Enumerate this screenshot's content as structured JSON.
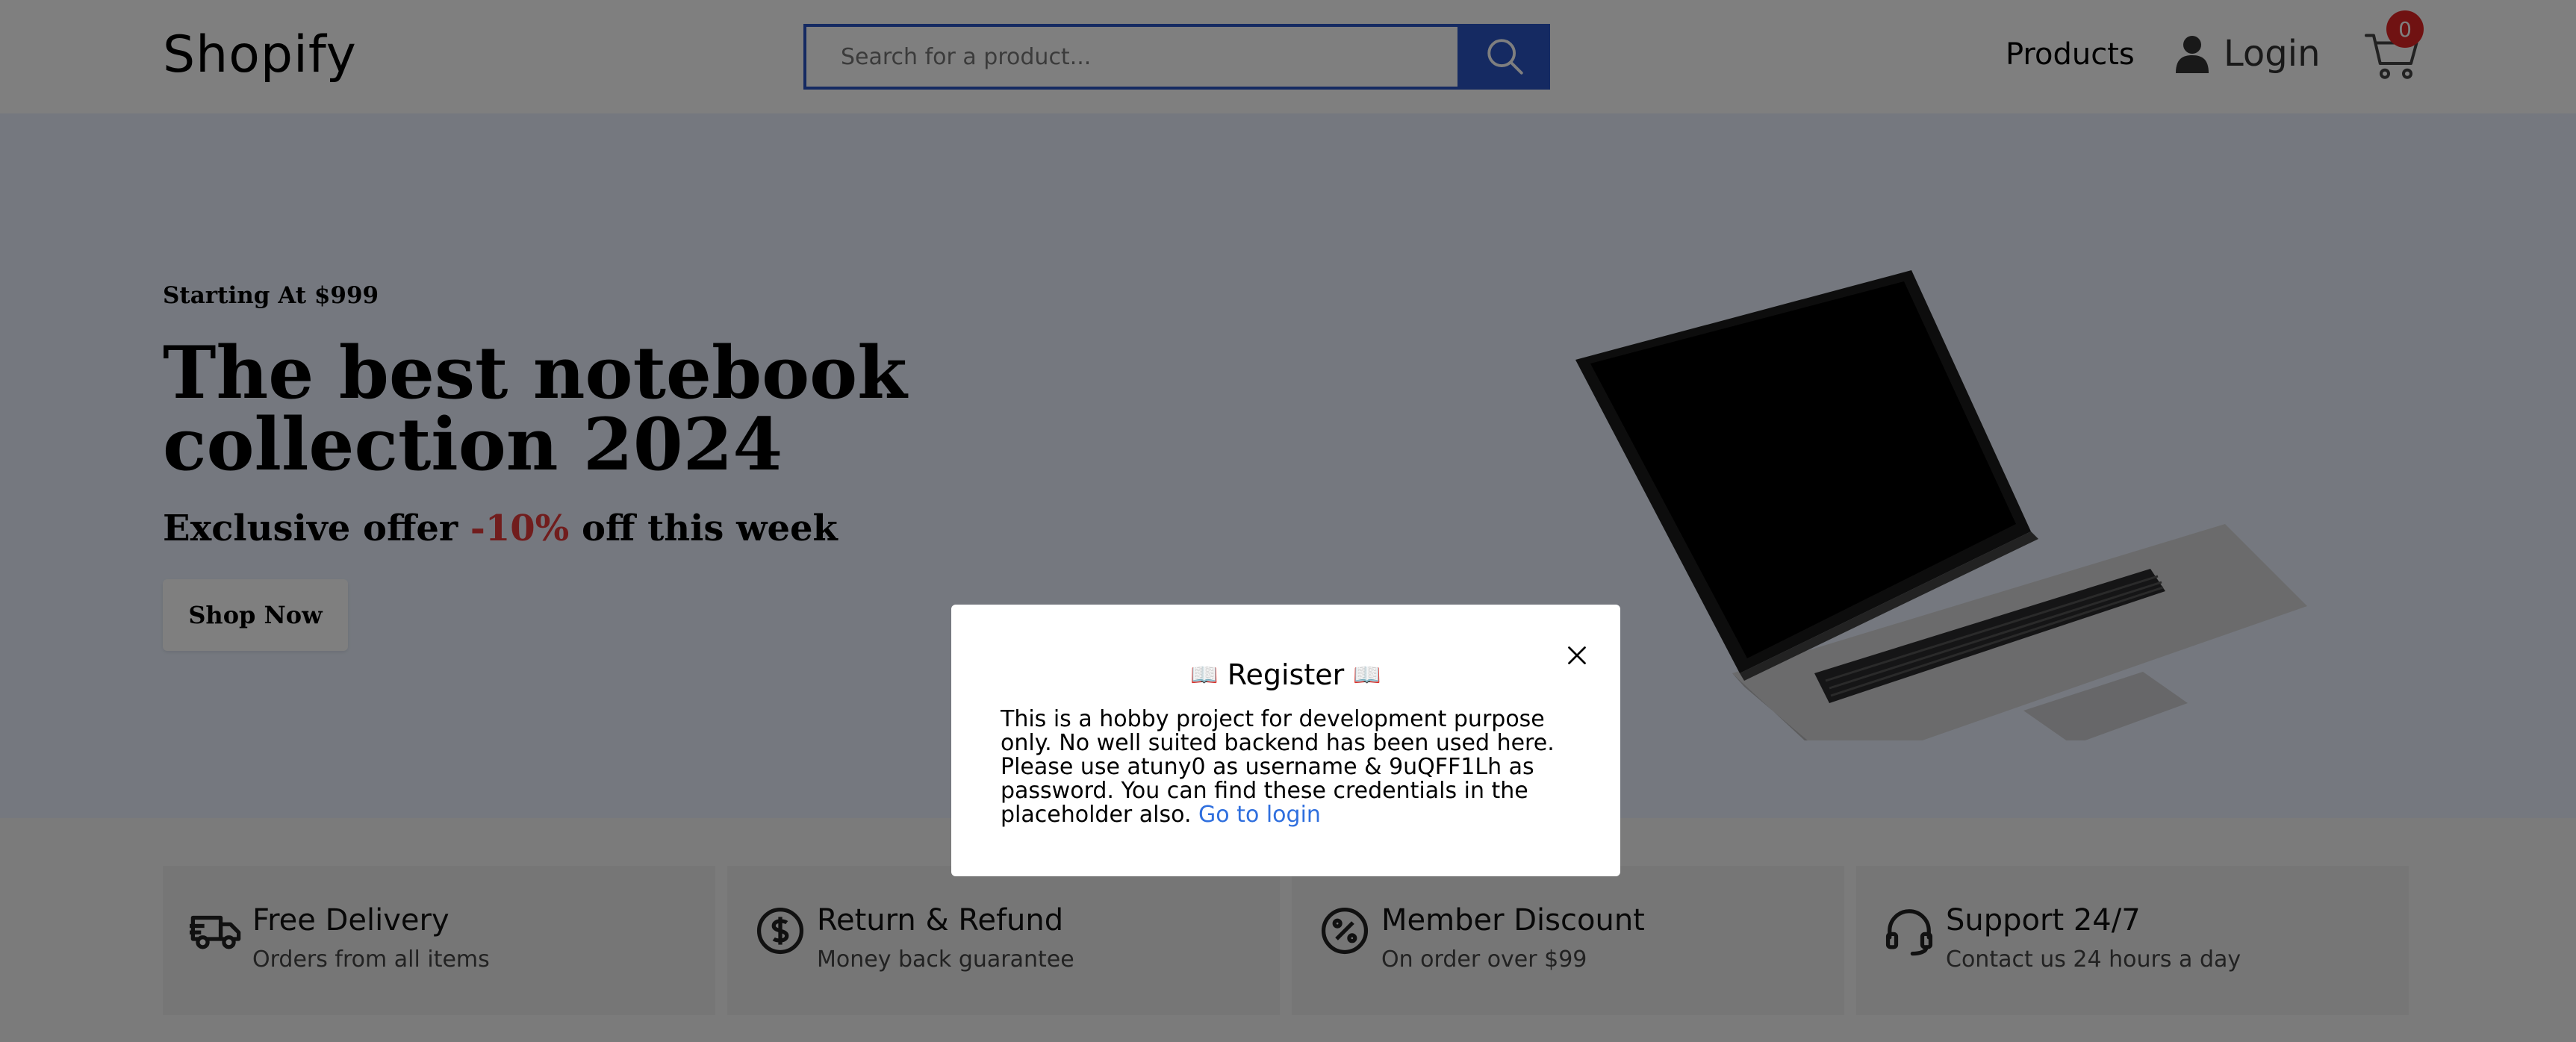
{
  "header": {
    "logo": "Shopify",
    "search_placeholder": "Search for a product...",
    "products_label": "Products",
    "login_label": "Login",
    "cart_count": "0"
  },
  "hero": {
    "kicker": "Starting At $999",
    "title": "The best notebook collection 2024",
    "offer_prefix": "Exclusive offer ",
    "offer_accent": "-10%",
    "offer_suffix": " off this week",
    "shop_button": "Shop Now"
  },
  "features": [
    {
      "title": "Free Delivery",
      "subtitle": "Orders from all items",
      "icon": "truck-icon"
    },
    {
      "title": "Return & Refund",
      "subtitle": "Money back guarantee",
      "icon": "dollar-circle-icon"
    },
    {
      "title": "Member Discount",
      "subtitle": "On order over $99",
      "icon": "percent-circle-icon"
    },
    {
      "title": "Support 24/7",
      "subtitle": "Contact us 24 hours a day",
      "icon": "headset-icon"
    }
  ],
  "modal": {
    "title": "Register",
    "title_emoji": "📖",
    "body": "This is a hobby project for development purpose only. No well suited backend has been used here. Please use atuny0 as username & 9uQFF1Lh as password. You can find these credentials in the placeholder also.",
    "link": "Go to login"
  },
  "colors": {
    "accent_blue": "#2b55c4",
    "offer_red": "#e33b3b",
    "link_blue": "#2f6fde",
    "badge_red": "#e02424"
  }
}
